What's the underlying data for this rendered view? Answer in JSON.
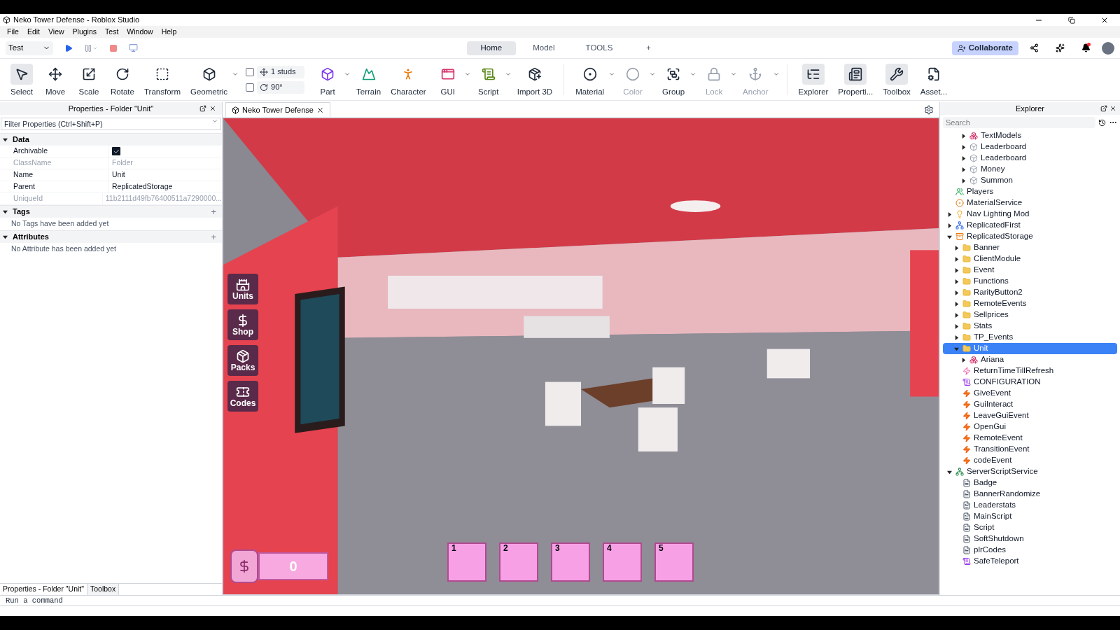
{
  "window": {
    "title": "Neko Tower Defense - Roblox Studio"
  },
  "menu": [
    "File",
    "Edit",
    "View",
    "Plugins",
    "Test",
    "Window",
    "Help"
  ],
  "test_mode": {
    "value": "Test"
  },
  "tabs": [
    {
      "label": "Home",
      "selected": true
    },
    {
      "label": "Model",
      "selected": false
    },
    {
      "label": "TOOLS",
      "selected": false
    }
  ],
  "add_tab": "+",
  "collaborate": "Collaborate",
  "notifications": {
    "unread": true
  },
  "ribbon": [
    {
      "label": "Select",
      "selected": true,
      "disabled": false,
      "dropdown": false
    },
    {
      "label": "Move",
      "selected": false,
      "disabled": false,
      "dropdown": false
    },
    {
      "label": "Scale",
      "selected": false,
      "disabled": false,
      "dropdown": false
    },
    {
      "label": "Rotate",
      "selected": false,
      "disabled": false,
      "dropdown": false
    },
    {
      "label": "Transform",
      "selected": false,
      "disabled": false,
      "dropdown": false
    },
    {
      "label": "Geometric",
      "selected": false,
      "disabled": false,
      "dropdown": true
    },
    {
      "kind": "snap",
      "rows": [
        {
          "value": "1 studs",
          "checked": false
        },
        {
          "value": "90°",
          "checked": false
        }
      ]
    },
    {
      "label": "Part",
      "selected": false,
      "disabled": false,
      "dropdown": true
    },
    {
      "label": "Terrain",
      "selected": false,
      "disabled": false,
      "dropdown": false
    },
    {
      "label": "Character",
      "selected": false,
      "disabled": false,
      "dropdown": false
    },
    {
      "label": "GUI",
      "selected": false,
      "disabled": false,
      "dropdown": true
    },
    {
      "label": "Script",
      "selected": false,
      "disabled": false,
      "dropdown": true
    },
    {
      "label": "Import 3D",
      "selected": false,
      "disabled": false,
      "dropdown": false
    },
    {
      "kind": "divider"
    },
    {
      "label": "Material",
      "selected": false,
      "disabled": false,
      "dropdown": true
    },
    {
      "label": "Color",
      "selected": false,
      "disabled": true,
      "dropdown": true
    },
    {
      "label": "Group",
      "selected": false,
      "disabled": false,
      "dropdown": true
    },
    {
      "label": "Lock",
      "selected": false,
      "disabled": true,
      "dropdown": true
    },
    {
      "label": "Anchor",
      "selected": false,
      "disabled": true,
      "dropdown": true
    },
    {
      "kind": "divider"
    },
    {
      "label": "Explorer",
      "selected": true,
      "disabled": false,
      "dropdown": false
    },
    {
      "label": "Properti...",
      "selected": true,
      "disabled": false,
      "dropdown": false
    },
    {
      "label": "Toolbox",
      "selected": true,
      "disabled": false,
      "dropdown": false
    },
    {
      "label": "Asset...",
      "selected": false,
      "disabled": false,
      "dropdown": false
    }
  ],
  "properties": {
    "title": "Properties - Folder \"Unit\"",
    "filter": {
      "placeholder": "Filter Properties (Ctrl+Shift+P)"
    },
    "sections": [
      {
        "name": "Data",
        "expanded": true,
        "rows": [
          {
            "name": "Archivable",
            "kind": "checkbox",
            "checked": true,
            "disabled": false
          },
          {
            "name": "ClassName",
            "kind": "text",
            "value": "Folder",
            "disabled": true
          },
          {
            "name": "Name",
            "kind": "text",
            "value": "Unit",
            "disabled": false
          },
          {
            "name": "Parent",
            "kind": "text",
            "value": "ReplicatedStorage",
            "disabled": false
          },
          {
            "name": "UniqueId",
            "kind": "text",
            "value": "11b2111d49fb76400511a7290000...",
            "disabled": true
          }
        ]
      },
      {
        "name": "Tags",
        "expanded": true,
        "add": "+",
        "empty_text": "No Tags have been added yet"
      },
      {
        "name": "Attributes",
        "expanded": true,
        "add": "+",
        "empty_text": "No Attribute has been added yet"
      }
    ]
  },
  "left_tabs": [
    {
      "label": "Properties - Folder \"Unit\"",
      "selected": true
    },
    {
      "label": "Toolbox",
      "selected": false
    }
  ],
  "viewport": {
    "tab": "Neko Tower Defense",
    "side_buttons": [
      {
        "label": "Units"
      },
      {
        "label": "Shop"
      },
      {
        "label": "Packs"
      },
      {
        "label": "Codes"
      }
    ],
    "money": "0",
    "slots": [
      "1",
      "2",
      "3",
      "4",
      "5"
    ]
  },
  "explorer": {
    "title": "Explorer",
    "search": {
      "placeholder": "Search"
    },
    "partial_children": [
      {
        "label": "TextModels",
        "kind": "models",
        "expanded": false,
        "selected": false
      },
      {
        "label": "Leaderboard",
        "kind": "model",
        "expanded": false,
        "selected": false
      },
      {
        "label": "Leaderboard",
        "kind": "model",
        "expanded": false,
        "selected": false
      },
      {
        "label": "Money",
        "kind": "model",
        "expanded": false,
        "selected": false
      },
      {
        "label": "Summon",
        "kind": "model",
        "expanded": false,
        "selected": false
      }
    ],
    "items": [
      {
        "label": "Players",
        "kind": "players",
        "selected": false
      },
      {
        "label": "MaterialService",
        "kind": "material",
        "selected": false
      },
      {
        "label": "Nav Lighting Mod",
        "kind": "light",
        "expanded": false,
        "selected": false
      },
      {
        "label": "ReplicatedFirst",
        "kind": "first",
        "expanded": false,
        "selected": false
      },
      {
        "label": "ReplicatedStorage",
        "kind": "storage",
        "expanded": true,
        "selected": false,
        "children": [
          {
            "label": "Banner",
            "kind": "folder",
            "expanded": false,
            "selected": false
          },
          {
            "label": "ClientModule",
            "kind": "folder",
            "expanded": false,
            "selected": false
          },
          {
            "label": "Event",
            "kind": "folder",
            "expanded": false,
            "selected": false
          },
          {
            "label": "Functions",
            "kind": "folder",
            "expanded": false,
            "selected": false
          },
          {
            "label": "RarityButton2",
            "kind": "folder",
            "expanded": false,
            "selected": false
          },
          {
            "label": "RemoteEvents",
            "kind": "folder",
            "expanded": false,
            "selected": false
          },
          {
            "label": "Sellprices",
            "kind": "folder",
            "expanded": false,
            "selected": false
          },
          {
            "label": "Stats",
            "kind": "folder",
            "expanded": false,
            "selected": false
          },
          {
            "label": "TP_Events",
            "kind": "folder",
            "expanded": false,
            "selected": false
          },
          {
            "label": "Unit",
            "kind": "folder",
            "expanded": true,
            "selected": true,
            "children": [
              {
                "label": "Ariana",
                "kind": "models",
                "expanded": false,
                "selected": false
              }
            ]
          },
          {
            "label": "ReturnTimeTillRefresh",
            "kind": "function",
            "selected": false
          },
          {
            "label": "CONFIGURATION",
            "kind": "module",
            "selected": false
          },
          {
            "label": "GiveEvent",
            "kind": "remote",
            "selected": false
          },
          {
            "label": "GuiInteract",
            "kind": "remote",
            "selected": false
          },
          {
            "label": "LeaveGuiEvent",
            "kind": "remote",
            "selected": false
          },
          {
            "label": "OpenGui",
            "kind": "remote",
            "selected": false
          },
          {
            "label": "RemoteEvent",
            "kind": "remote",
            "selected": false
          },
          {
            "label": "TransitionEvent",
            "kind": "remote",
            "selected": false
          },
          {
            "label": "codeEvent",
            "kind": "remote",
            "selected": false
          }
        ]
      },
      {
        "label": "ServerScriptService",
        "kind": "service",
        "expanded": true,
        "selected": false,
        "children": [
          {
            "label": "Badge",
            "kind": "script",
            "selected": false
          },
          {
            "label": "BannerRandomize",
            "kind": "script",
            "selected": false
          },
          {
            "label": "Leaderstats",
            "kind": "script",
            "selected": false
          },
          {
            "label": "MainScript",
            "kind": "script",
            "selected": false
          },
          {
            "label": "Script",
            "kind": "script",
            "selected": false
          },
          {
            "label": "SoftShutdown",
            "kind": "script",
            "selected": false
          },
          {
            "label": "plrCodes",
            "kind": "script",
            "selected": false
          },
          {
            "label": "SafeTeleport",
            "kind": "module",
            "selected": false
          }
        ]
      }
    ]
  },
  "command_bar": {
    "placeholder": "Run a command"
  }
}
